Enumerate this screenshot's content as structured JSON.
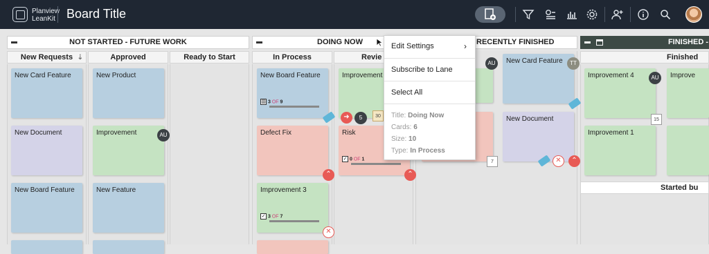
{
  "header": {
    "logo_line1": "Planview",
    "logo_line2": "LeanKit",
    "board_title": "Board Title",
    "icons": [
      "add-card-icon",
      "filter-icon",
      "lane-view-icon",
      "chart-icon",
      "gear-icon",
      "add-user-icon",
      "info-icon",
      "search-icon"
    ]
  },
  "lanes": {
    "not_started": "NOT STARTED - FUTURE WORK",
    "doing_now": "DOING NOW",
    "recently_finished": "RECENTLY FINISHED",
    "finished": "FINISHED -"
  },
  "columns": {
    "new_requests": "New Requests",
    "approved": "Approved",
    "ready_to_start": "Ready to Start",
    "in_process": "In Process",
    "review": "Revie",
    "finished_col": "Finished"
  },
  "cards": {
    "c1": "New Card Feature",
    "c2": "New Document",
    "c3": "New Board Feature",
    "c4": "New Product",
    "c5": "Improvement",
    "c6": "New Feature",
    "c7": "New Board Feature",
    "c8": "Defect Fix",
    "c9": "Improvement 3",
    "c10": "Improvement",
    "c11": "Risk",
    "c12": "New Card Feature",
    "c13": "New Document",
    "c14": "Improvement 4",
    "c15": "Improvement 1",
    "c16": "Improve"
  },
  "badges": {
    "au": "AU",
    "tt": "TT",
    "five": "5",
    "cal7": "7",
    "cal15": "15",
    "cal_review": "30"
  },
  "progress": {
    "p1_done": "3",
    "p1_of": "OF",
    "p1_total": "9",
    "p2_done": "0",
    "p2_of": "OF",
    "p2_total": "1",
    "p3_done": "3",
    "p3_of": "OF",
    "p3_total": "7"
  },
  "started_label": "Started bu",
  "menu": {
    "edit_settings": "Edit Settings",
    "subscribe": "Subscribe to Lane",
    "select_all": "Select All",
    "title_label": "Title:",
    "title_value": "Doing Now",
    "cards_label": "Cards:",
    "cards_value": "6",
    "size_label": "Size:",
    "size_value": "10",
    "type_label": "Type:",
    "type_value": "In Process",
    "chevron": "›"
  },
  "colors": {
    "topbar": "#1f2733",
    "blue_card": "#b7cfe0",
    "purple_card": "#d4d3e8",
    "green_card": "#c5e3c2",
    "red_card": "#f2c5bd",
    "block_red": "#e85a55",
    "tag_blue": "#5fb6d8",
    "finished_header": "#3d4a45"
  }
}
